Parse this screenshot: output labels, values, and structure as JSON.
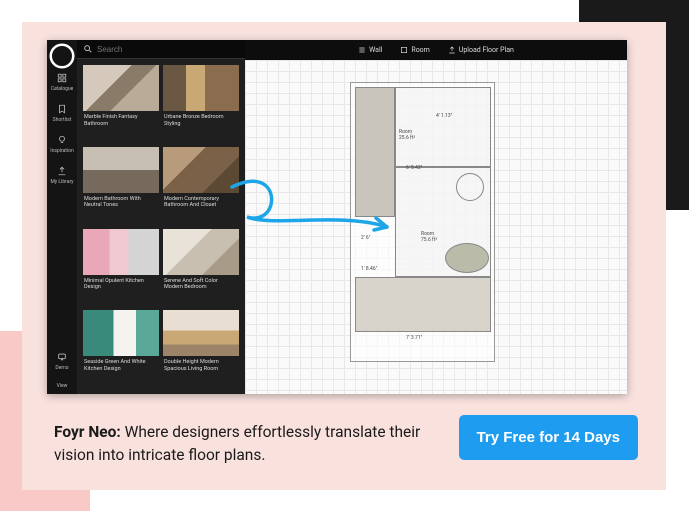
{
  "rail": {
    "items": [
      {
        "label": "Catalogue",
        "icon": "grid"
      },
      {
        "label": "Shortlist",
        "icon": "bookmark"
      },
      {
        "label": "Inspiration",
        "icon": "bulb"
      },
      {
        "label": "My Library",
        "icon": "upload"
      }
    ],
    "demo": "Demo",
    "view": "View"
  },
  "search": {
    "placeholder": "Search"
  },
  "catalogue": [
    {
      "title": "Marble Finish Fantasy Bathroom"
    },
    {
      "title": "Urbane Bronze Bedroom Styling"
    },
    {
      "title": "Modern Bathroom With Neutral Tones"
    },
    {
      "title": "Modern Contemporary Bathroom And Closet"
    },
    {
      "title": "Minimal Opulent Kitchen Design"
    },
    {
      "title": "Serene And Soft Color Modern Bedroom"
    },
    {
      "title": "Seaside Green And White Kitchen Design"
    },
    {
      "title": "Double Height Modern Spacious Living Room"
    }
  ],
  "toolbar": {
    "wall": "Wall",
    "room": "Room",
    "upload": "Upload Floor Plan"
  },
  "plan": {
    "room1": "Room",
    "room1_dim": "25.6 ft²",
    "room2": "Room",
    "room2_dim": "75.6 ft²",
    "d1": "4' 1.13\"",
    "d2": "6' 5.42\"",
    "d3": "2' 6\"",
    "d4": "1' 8.46\"",
    "d5": "7' 3.71\""
  },
  "caption": {
    "bold": "Foyr Neo:",
    "text": " Where designers effortlessly translate their vision into intricate floor plans."
  },
  "cta": "Try Free for 14 Days"
}
